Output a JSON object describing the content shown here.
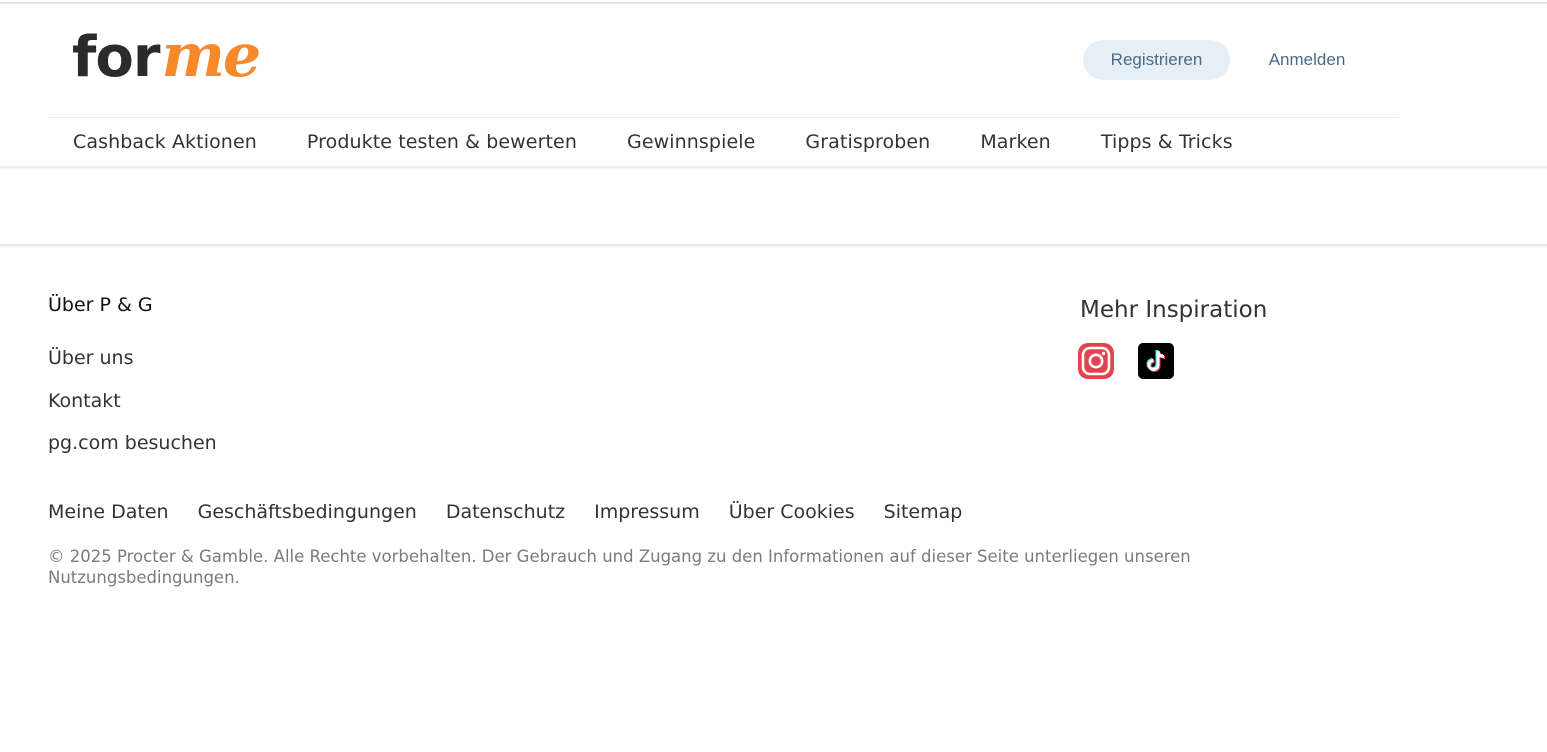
{
  "header": {
    "logo": {
      "part1": "for",
      "part2": "me"
    },
    "register_label": "Registrieren",
    "login_label": "Anmelden",
    "nav": [
      {
        "label": "Cashback Aktionen"
      },
      {
        "label": "Produkte testen & bewerten"
      },
      {
        "label": "Gewinnspiele"
      },
      {
        "label": "Gratisproben"
      },
      {
        "label": "Marken"
      },
      {
        "label": "Tipps & Tricks"
      }
    ]
  },
  "footer": {
    "about_heading": "Über P & G",
    "about_links": [
      {
        "label": "Über uns"
      },
      {
        "label": "Kontakt"
      },
      {
        "label": "pg.com besuchen"
      }
    ],
    "inspiration_title": "Mehr Inspiration",
    "social": [
      {
        "icon": "instagram-icon"
      },
      {
        "icon": "tiktok-icon"
      }
    ],
    "legal_links": [
      {
        "label": "Meine Daten"
      },
      {
        "label": "Geschäftsbedingungen"
      },
      {
        "label": "Datenschutz"
      },
      {
        "label": "Impressum"
      },
      {
        "label": "Über Cookies"
      },
      {
        "label": "Sitemap"
      }
    ],
    "copyright": "© 2025 Procter & Gamble. Alle Rechte vorbehalten. Der Gebrauch und Zugang zu den Informationen auf dieser Seite unterliegen unseren Nutzungsbedingungen."
  },
  "colors": {
    "brand_orange": "#f7892b",
    "logo_dark": "#2b2b2b",
    "button_bg": "#e7eff6",
    "button_text": "#4c6a87",
    "instagram": "#e1444f"
  }
}
